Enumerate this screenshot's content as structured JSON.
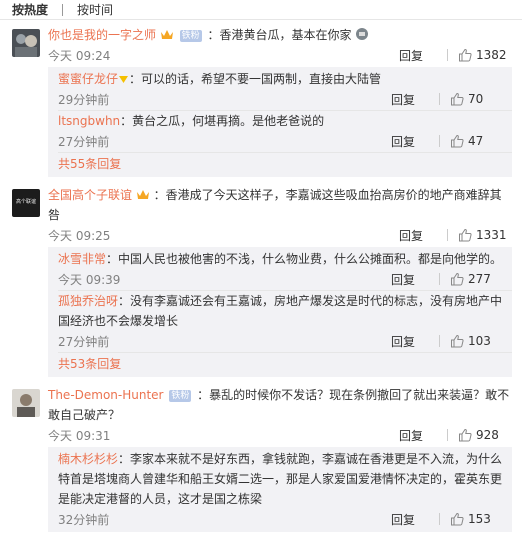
{
  "sort": {
    "hot": "按热度",
    "time": "按时间"
  },
  "reply_label": "回复",
  "comments": [
    {
      "user": "你也是我的一字之师",
      "vip": "铁粉",
      "text": "：香港黄台瓜，基本在你家",
      "time": "今天 09:24",
      "likes": "1382",
      "replies": [
        {
          "user": "蜜蜜仔龙仔",
          "text": "：可以的话，希望不要一国两制，直接由大陆管",
          "time": "29分钟前",
          "likes": "70"
        },
        {
          "user": "ltsngbwhn",
          "text": "：黄台之瓜，何堪再摘。是他老爸说的",
          "time": "27分钟前",
          "likes": "47"
        }
      ],
      "more": "共55条回复"
    },
    {
      "user": "全国高个子联谊",
      "avatar_text": "高个联谊",
      "text": "：香港成了今天这样子，李嘉诚这些吸血抬高房价的地产商难辞其咎",
      "time": "今天 09:25",
      "likes": "1331",
      "replies": [
        {
          "user": "冰雪非常",
          "text": "：中国人民也被他害的不浅，什么物业费，什么公摊面积。都是向他学的。",
          "time": "今天 09:39",
          "likes": "277"
        },
        {
          "user": "孤独乔治呀",
          "text": "：没有李嘉诚还会有王嘉诚，房地产爆发这是时代的标志，没有房地产中国经济也不会爆发增长",
          "time": "27分钟前",
          "likes": "103"
        }
      ],
      "more": "共53条回复"
    },
    {
      "user": "The-Demon-Hunter",
      "vip": "铁粉",
      "text": "：暴乱的时候你不发话？现在条例撤回了就出来装逼？敢不敢自己破产？",
      "time": "今天 09:31",
      "likes": "928",
      "replies": [
        {
          "user": "楠木杉杉杉",
          "text": "：李家本来就不是好东西，拿钱就跑，李嘉诚在香港更是不入流，为什么特首是塔塊商人曾建华和船王女婿二选一，那是人家爱国爱港情怀决定的，霍英东更是能决定港督的人员，这才是国之栋梁",
          "time": "32分钟前",
          "likes": "153"
        }
      ],
      "more": ""
    }
  ]
}
